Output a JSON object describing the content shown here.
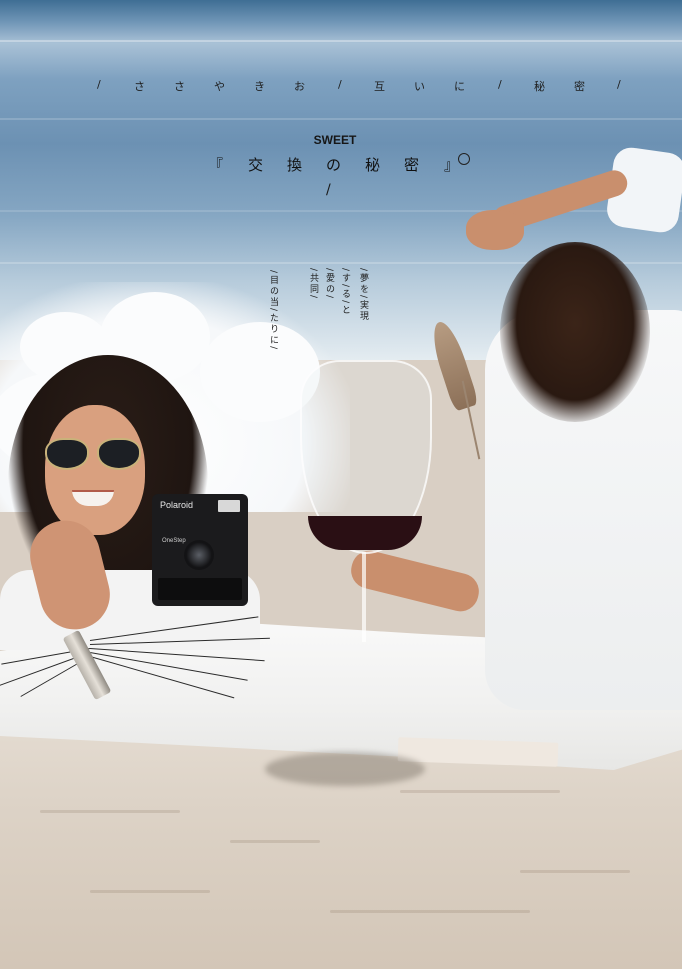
{
  "top_line": {
    "chars": [
      "/",
      "さ",
      "さ",
      "や",
      "き",
      "お",
      "/",
      "互",
      "い",
      "に",
      "/",
      "秘",
      "密",
      "/"
    ]
  },
  "title_block": {
    "subtitle": "SWEET",
    "open_bracket": "『",
    "title_chars": [
      "交",
      "換",
      "の",
      "秘",
      "密"
    ],
    "close_bracket": "』",
    "slash": "/"
  },
  "vertical_text": {
    "col1": "/夢を/実現",
    "col2": "/す/る/と",
    "col3": "/愛の/",
    "col4": "/共同/",
    "col5": "/目の当/たりに/"
  },
  "camera": {
    "brand": "Polaroid",
    "model": "OneStep"
  },
  "colors": {
    "sea": "#6c91b3",
    "sand": "#ddd3c7",
    "wine": "#2a0f14",
    "text": "#1e1e1e"
  }
}
